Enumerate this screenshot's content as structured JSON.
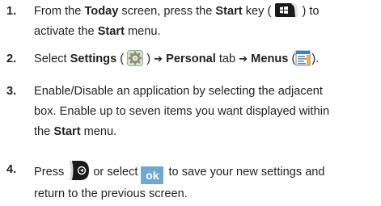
{
  "steps": [
    {
      "number": "1.",
      "line1": {
        "t1": "From the ",
        "b1": "Today",
        "t2": " screen, press the ",
        "b2": "Start",
        "t3": " key ( ",
        "t4": " ) to"
      },
      "line2": {
        "t1": "activate the ",
        "b1": "Start",
        "t2": " menu."
      }
    },
    {
      "number": "2.",
      "line1": {
        "t1": "Select ",
        "b1": "Settings",
        "t2": " ( ",
        "t3": " ) ",
        "arrow1": "➔",
        "t4": " ",
        "b2": "Personal",
        "t5": " tab ",
        "arrow2": "➔",
        "t6": " ",
        "b3": "Menus",
        "t7": " (",
        "t8": ")."
      }
    },
    {
      "number": "3.",
      "line1": "Enable/Disable an application by selecting the adjacent",
      "line2": "box. Enable up to seven items you want displayed within",
      "line3": {
        "t1": "the ",
        "b1": "Start",
        "t2": " menu."
      }
    },
    {
      "number": "4.",
      "line1": {
        "t1": "Press",
        "t2": "or select",
        "ok_label": "ok",
        "t3": "to save your new settings and"
      },
      "line2": "return to the previous screen."
    }
  ],
  "icons": {
    "start_key": "windows-start-key-icon",
    "settings": "settings-gear-icon",
    "menus": "menus-window-icon",
    "back_key": "back-key-icon",
    "ok_softkey": "ok-softkey-icon"
  },
  "colors": {
    "text": "#231f20",
    "ok_button": "#6fa9d1",
    "key_black": "#1a1a1a"
  }
}
